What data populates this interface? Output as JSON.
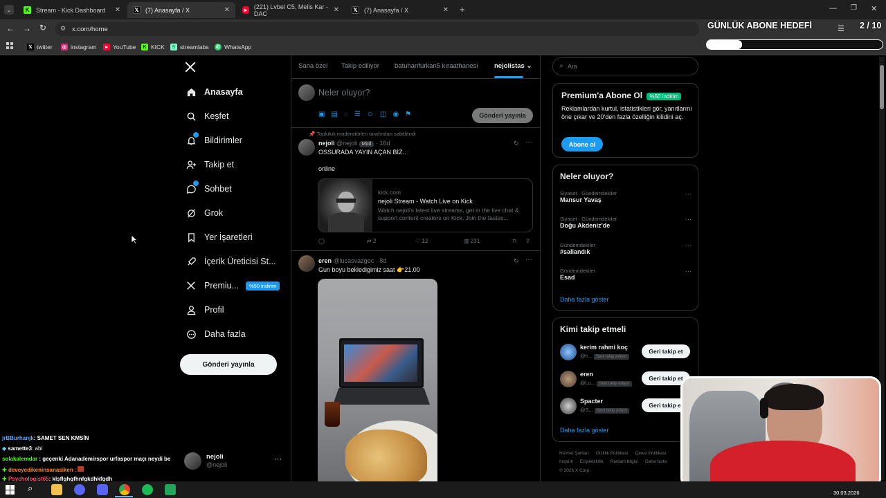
{
  "browser": {
    "tabs": [
      {
        "title": "Stream - Kick Dashboard",
        "active": false,
        "favicon": "kick-icon",
        "color": "#53fc18"
      },
      {
        "title": "(7) Anasayfa / X",
        "active": true,
        "favicon": "x-icon",
        "color": "#ffffff"
      },
      {
        "title": "(221) Lvbel C5, Melis Kar - DAC",
        "active": false,
        "favicon": "youtube-icon",
        "color": "#ff0033"
      },
      {
        "title": "(7) Anasayfa / X",
        "active": false,
        "favicon": "x-icon",
        "color": "#ffffff"
      }
    ],
    "url": "x.com/home",
    "bookmarks": [
      {
        "label": "twitter",
        "icon": "x-icon"
      },
      {
        "label": "instagram",
        "icon": "instagram-icon"
      },
      {
        "label": "YouTube",
        "icon": "youtube-icon"
      },
      {
        "label": "KICK",
        "icon": "kick-icon"
      },
      {
        "label": "streamlabs",
        "icon": "streamlabs-icon"
      },
      {
        "label": "WhatsApp",
        "icon": "whatsapp-icon"
      }
    ]
  },
  "overlay": {
    "goal_title": "GÜNLÜK ABONE HEDEFİ",
    "goal_count": "2 / 10",
    "goal_progress": 0.2
  },
  "x_nav": {
    "items": [
      {
        "label": "Anasayfa",
        "icon": "home-icon"
      },
      {
        "label": "Keşfet",
        "icon": "search-icon"
      },
      {
        "label": "Bildirimler",
        "icon": "bell-icon"
      },
      {
        "label": "Takip et",
        "icon": "add-user-icon"
      },
      {
        "label": "Sohbet",
        "icon": "chat-icon"
      },
      {
        "label": "Grok",
        "icon": "grok-icon"
      },
      {
        "label": "Yer İşaretleri",
        "icon": "bookmark-icon"
      },
      {
        "label": "İçerik Üreticisi St...",
        "icon": "rocket-icon"
      },
      {
        "label": "Premiu...",
        "icon": "x-icon"
      },
      {
        "label": "Profil",
        "icon": "user-icon"
      },
      {
        "label": "Daha fazla",
        "icon": "more-circle-icon"
      }
    ],
    "premium_badge": "%50 indirim",
    "post_button": "Gönderi yayınla",
    "profile_name": "nejoli",
    "profile_handle": "@nejoli"
  },
  "feed": {
    "tabs": [
      "Sana özel",
      "Takip ediliyor",
      "batuhanfurkan5 kıraathanesi",
      "nejolistas"
    ],
    "compose_placeholder": "Neler oluyor?",
    "compose_button": "Gönderi yayınla",
    "pinned_label": "Topluluk moderatörleri tarafından sabitlendi",
    "tweet1": {
      "name": "nejoli",
      "handle": "@nejoli",
      "badge": "Mod",
      "time": "· 16d",
      "text": "OSSURADA YAYIN AÇAN BİZ..",
      "text2": "online",
      "card_domain": "kick.com",
      "card_title": "nejoli Stream - Watch Live on Kick",
      "card_desc": "Watch nejoli's latest live streams, get in the live chat & support content creators on Kick. Join the fastes...",
      "retweets": "2",
      "likes": "12",
      "views": "231"
    },
    "tweet2": {
      "name": "eren",
      "handle": "@lucasvazgec",
      "time": "· 8d",
      "text": "Gun boyu bekledigimiz saat 👉21.00"
    }
  },
  "right": {
    "search_placeholder": "Ara",
    "premium_title": "Premium'a Abone Ol",
    "premium_badge": "%50 indirim",
    "premium_desc": "Reklamlardan kurtul, istatistikleri gör, yanıtlarını öne çıkar ve 20'den fazla özelliğin kilidini aç.",
    "premium_button": "Abone ol",
    "trends_title": "Neler oluyor?",
    "trends": [
      {
        "category": "Siyaset · Gündemdekiler",
        "name": "Mansur Yavaş"
      },
      {
        "category": "Siyaset · Gündemdekiler",
        "name": "Doğu Akdeniz'de"
      },
      {
        "category": "Gündemdekiler",
        "name": "#sallandık"
      },
      {
        "category": "Gündemdekiler",
        "name": "Esad"
      }
    ],
    "trends_more": "Daha fazla göster",
    "who_title": "Kimi takip etmeli",
    "who": [
      {
        "name": "kerim rahmi koç",
        "handle": "@h...",
        "tag": "Seni takip ediyor",
        "button": "Geri takip et"
      },
      {
        "name": "eren",
        "handle": "@Lu...",
        "tag": "Seni takip ediyor",
        "button": "Geri takip et"
      },
      {
        "name": "Spacter",
        "handle": "@S...",
        "tag": "Seni takip ediyor",
        "button": "Geri takip et"
      }
    ],
    "who_more": "Daha fazla göster",
    "footer1": [
      "Hizmet Şartları",
      "Gizlilik Politikası",
      "Çerez Politikası"
    ],
    "footer2": [
      "Imprint",
      "Erişilebilirlik",
      "Reklam bilgisi",
      "Daha fazla"
    ],
    "copyright": "© 2026 X Corp."
  },
  "chat": [
    {
      "user": "jrBBurhanjk",
      "text": ": SAMET SEN KMSİN",
      "color": "#5aa7ff"
    },
    {
      "user": "samette3",
      "text": ": abi",
      "color": "#ffffff"
    },
    {
      "user": "solakalemdar",
      "text": ": geçenki Adanademirspor urfaspor maçı neydi be",
      "color": "#53fc18"
    },
    {
      "user": "deveyedikeninsanasiken",
      "text": ":",
      "color": "#ff8a2a"
    },
    {
      "user": "Psychologist65",
      "text": ": klşflghgfhnfgkdhkfgdh",
      "color": "#ff4d6d"
    }
  ],
  "taskbar": {
    "date": "30.03.2026"
  }
}
